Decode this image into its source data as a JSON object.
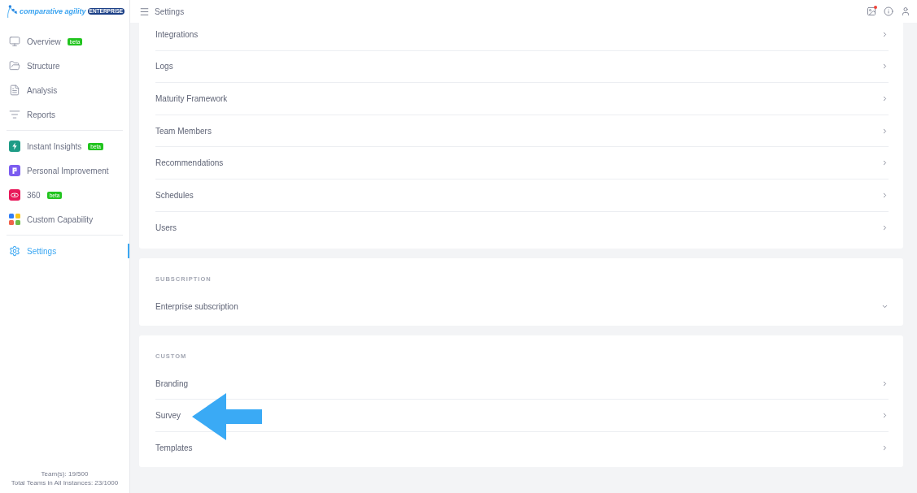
{
  "logo": {
    "name": "comparative agility",
    "badge": "ENTERPRISE"
  },
  "header": {
    "title": "Settings",
    "unread_notifications": true
  },
  "sidebar": {
    "groups": [
      {
        "items": [
          {
            "label": "Overview",
            "badge": "beta",
            "selected": false
          },
          {
            "label": "Structure",
            "selected": false
          },
          {
            "label": "Analysis",
            "selected": false
          },
          {
            "label": "Reports",
            "selected": false
          }
        ]
      },
      {
        "items": [
          {
            "label": "Instant Insights",
            "badge": "beta",
            "selected": false
          },
          {
            "label": "Personal Improvement",
            "selected": false
          },
          {
            "label": "360",
            "badge": "beta",
            "selected": false
          },
          {
            "label": "Custom Capability",
            "selected": false
          }
        ]
      },
      {
        "items": [
          {
            "label": "Settings",
            "selected": true
          }
        ]
      }
    ],
    "footer": [
      "Team(s): 19/500",
      "Total Teams in All Instances: 23/1000"
    ]
  },
  "sections": [
    {
      "rows": [
        {
          "label": "Integrations",
          "kind": "link",
          "pointed_at": false
        },
        {
          "label": "Logs",
          "kind": "link",
          "pointed_at": false
        },
        {
          "label": "Maturity Framework",
          "kind": "link",
          "pointed_at": false
        },
        {
          "label": "Team Members",
          "kind": "link",
          "pointed_at": false
        },
        {
          "label": "Recommendations",
          "kind": "link",
          "pointed_at": false
        },
        {
          "label": "Schedules",
          "kind": "link",
          "pointed_at": false
        },
        {
          "label": "Users",
          "kind": "link",
          "pointed_at": false
        }
      ]
    },
    {
      "heading": "SUBSCRIPTION",
      "rows": [
        {
          "label": "Enterprise subscription",
          "kind": "expandable",
          "pointed_at": false
        }
      ]
    },
    {
      "heading": "CUSTOM",
      "rows": [
        {
          "label": "Branding",
          "kind": "link",
          "pointed_at": false
        },
        {
          "label": "Survey",
          "kind": "link",
          "pointed_at": true
        },
        {
          "label": "Templates",
          "kind": "link",
          "pointed_at": false
        }
      ]
    }
  ]
}
